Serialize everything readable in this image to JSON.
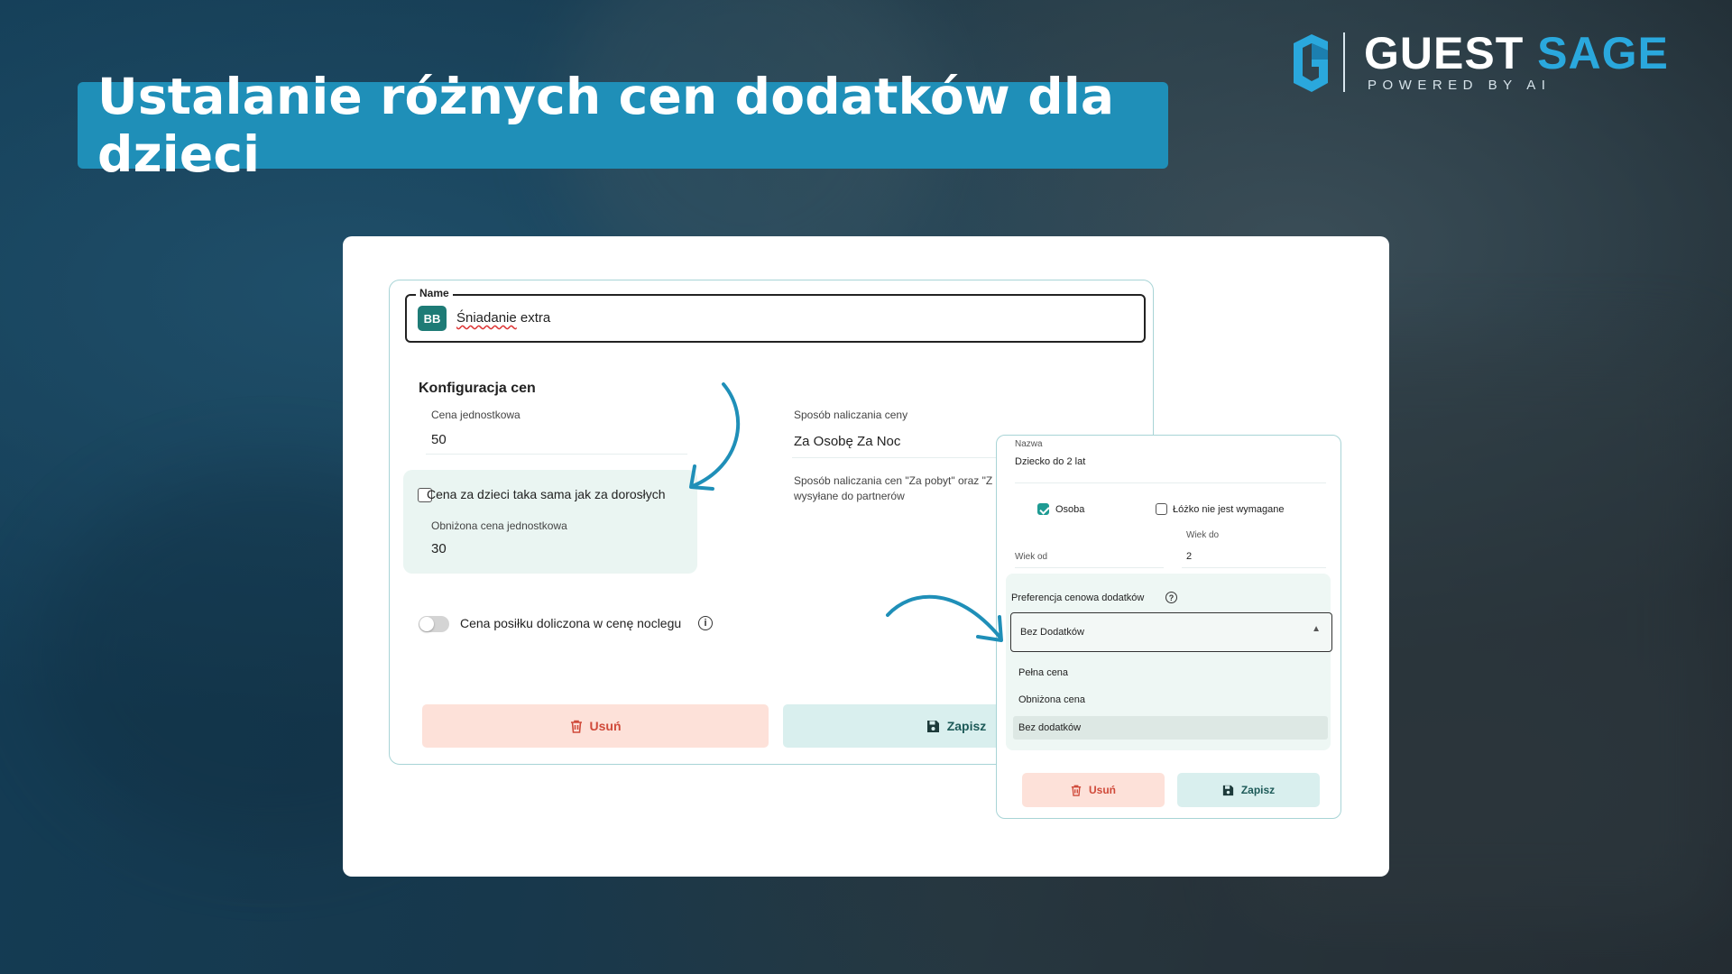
{
  "banner": {
    "title": "Ustalanie różnych cen dodatków dla dzieci"
  },
  "logo": {
    "word1": "GUEST",
    "word2": "SAGE",
    "tagline": "POWERED BY AI"
  },
  "form": {
    "name_label": "Name",
    "avatar": "BB",
    "name_value_part1": "Śniadanie",
    "name_value_part2": " extra",
    "section_title": "Konfiguracja cen",
    "unit_price_label": "Cena jednostkowa",
    "unit_price_value": "50",
    "charging_label": "Sposób naliczania ceny",
    "charging_value": "Za Osobę Za Noc",
    "charging_note": "Sposób naliczania cen \"Za pobyt\" oraz \"Z",
    "charging_note2": "wysyłane do partnerów",
    "kids_same_price_label": "Cena za dzieci taka sama jak za dorosłych",
    "kids_same_price_checked": false,
    "reduced_price_label": "Obniżona cena jednostkowa",
    "reduced_price_value": "30",
    "meal_included_label": "Cena posiłku doliczona w cenę noclegu",
    "meal_included_on": false,
    "delete_label": "Usuń",
    "save_label": "Zapisz"
  },
  "popup": {
    "name_label": "Nazwa",
    "name_value": "Dziecko do 2 lat",
    "person_label": "Osoba",
    "person_checked": true,
    "bed_label": "Łóżko nie jest wymagane",
    "bed_checked": false,
    "age_from_label": "Wiek od",
    "age_from_value": "",
    "age_to_label": "Wiek do",
    "age_to_value": "2",
    "pref_label": "Preferencja cenowa dodatków",
    "select_value": "Bez Dodatków",
    "options": [
      "Pełna cena",
      "Obniżona cena",
      "Bez dodatków"
    ],
    "selected_option": "Bez dodatków",
    "delete_label": "Usuń",
    "save_label": "Zapisz"
  },
  "colors": {
    "banner": "#1f8fb8",
    "accent": "#1e9b93",
    "danger": "#d04a3a",
    "brand_blue": "#2aa8dd"
  }
}
